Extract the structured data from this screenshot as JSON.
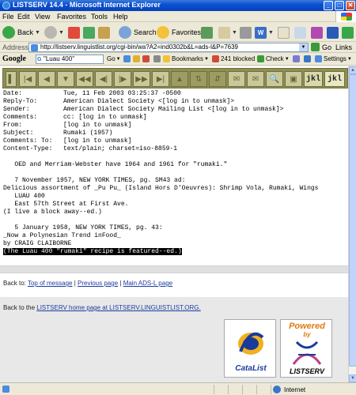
{
  "window": {
    "title": "LISTSERV 14.4 - Microsoft Internet Explorer",
    "controls": {
      "minimize": "_",
      "maximize": "□",
      "close": "✕"
    }
  },
  "menu": [
    "File",
    "Edit",
    "View",
    "Favorites",
    "Tools",
    "Help"
  ],
  "toolbar": {
    "back": "Back",
    "search": "Search",
    "favorites": "Favorites"
  },
  "address": {
    "label": "Address",
    "url": "http://listserv.linguistlist.org/cgi-bin/wa?A2=ind0302b&L=ads-l&P=7639",
    "go": "Go",
    "links": "Links"
  },
  "google": {
    "logo": "Google",
    "query": "\"Luau 400\"",
    "go": "Go",
    "bookmarks": "Bookmarks",
    "blocked": "241 blocked",
    "check": "Check",
    "settings": "Settings"
  },
  "nav_text_buttons": [
    "jkl",
    "jkl"
  ],
  "message": {
    "headers": [
      {
        "key": "Date:",
        "value": "Tue, 11 Feb 2003 03:25:37 -0500"
      },
      {
        "key": "Reply-To:",
        "value": "American Dialect Society <[log in to unmask]>"
      },
      {
        "key": "Sender:",
        "value": "American Dialect Society Mailing List <[log in to unmask]>"
      },
      {
        "key": "Comments:",
        "value": "cc: [log in to unmask]"
      },
      {
        "key": "From:",
        "value": "[log in to unmask]"
      },
      {
        "key": "Subject:",
        "value": "Rumaki (1957)"
      },
      {
        "key": "Comments: To:",
        "value": "[log in to unmask]"
      },
      {
        "key": "Content-Type:",
        "value": "text/plain; charset=iso-8859-1"
      }
    ],
    "body": [
      "",
      "   OED and Merriam-Webster have 1964 and 1961 for \"rumaki.\"",
      "",
      "   7 November 1957, NEW YORK TIMES, pg. SM43 ad:",
      "Delicious assortment of _Pu Pu_ (Island Hors D'Oeuvres): Shrimp Vola, Rumaki, Wings",
      "   LUAU 400",
      "   East 57th Street at First Ave.",
      "(I live a block away--ed.)",
      "",
      "   5 January 1958, NEW YORK TIMES, pg. 43:",
      "_Now a Polynesian Trend inFood_",
      "by CRAIG CLAIBORNE"
    ],
    "highlighted": "(The Luau 400 \"rumaki\" recipe is featured--ed.)"
  },
  "back_links": {
    "prefix": "Back to: ",
    "top": "Top of message",
    "sep": " | ",
    "previous": "Previous page",
    "main": "Main ADS-L page"
  },
  "footer": {
    "prefix": "Back to the ",
    "link": "LISTSERV home page at LISTSERV.LINGUISTLIST.ORG.",
    "catalist": "CataList",
    "powered": "Powered",
    "by": "by",
    "listserv": "LISTSERV"
  },
  "status": {
    "zone": "Internet"
  }
}
